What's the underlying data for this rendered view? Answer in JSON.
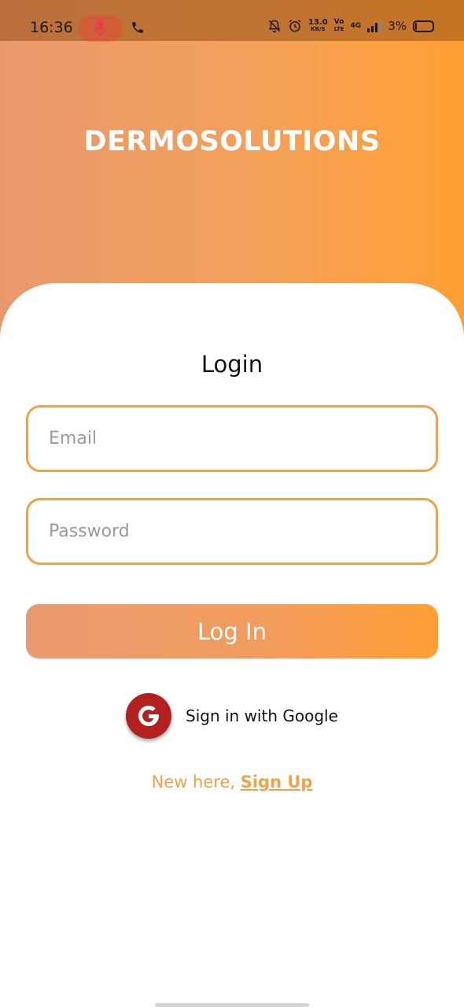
{
  "status_bar": {
    "time": "16:36",
    "speed_value": "13.0",
    "speed_unit": "KB/S",
    "volte_top": "Vo",
    "volte_bottom": "LTE",
    "network": "4G",
    "battery": "3%"
  },
  "header": {
    "app_title": "DERMOSOLUTIONS"
  },
  "login": {
    "heading": "Login",
    "email_placeholder": "Email",
    "password_placeholder": "Password",
    "login_button": "Log In",
    "google_label": "Sign in with Google",
    "signup_prefix": "New here, ",
    "signup_link": "Sign Up"
  },
  "colors": {
    "accent": "#f0a24a",
    "gradient_start": "#e9986d",
    "gradient_end": "#ff9f33",
    "google_red": "#b32020"
  }
}
